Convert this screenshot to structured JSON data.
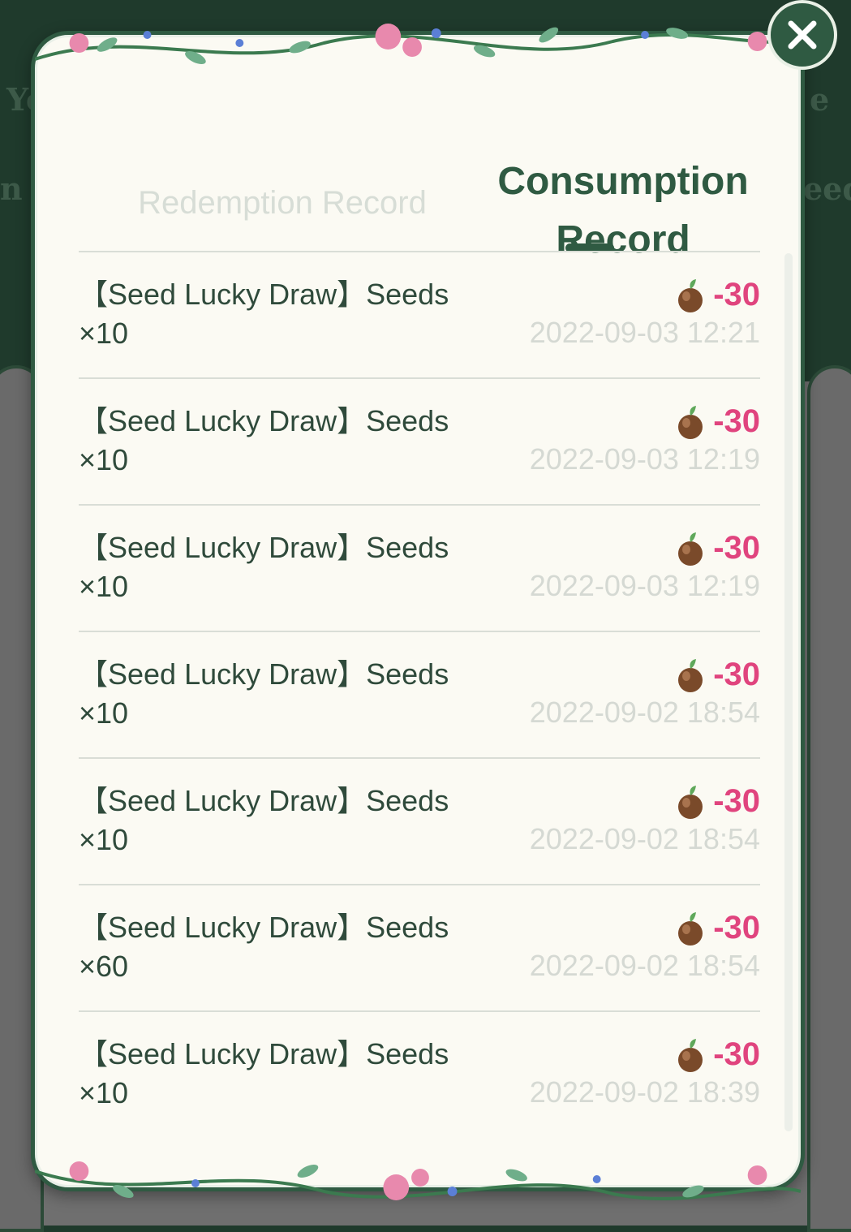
{
  "background": {
    "fringe_left_1": "Yo",
    "fringe_left_2": "n t",
    "fringe_right_1": "e",
    "fringe_right_2": "eed"
  },
  "tabs": {
    "inactive": "Redemption Record",
    "active_line1": "Consumption",
    "active_line2": "Record"
  },
  "colors": {
    "brand_green": "#2f5a42",
    "amount_pink": "#e0447e",
    "muted_gray": "#d5d9d3"
  },
  "records": [
    {
      "title": "【Seed Lucky Draw】Seeds ×10",
      "amount": "-30",
      "time": "2022-09-03 12:21"
    },
    {
      "title": "【Seed Lucky Draw】Seeds ×10",
      "amount": "-30",
      "time": "2022-09-03 12:19"
    },
    {
      "title": "【Seed Lucky Draw】Seeds ×10",
      "amount": "-30",
      "time": "2022-09-03 12:19"
    },
    {
      "title": "【Seed Lucky Draw】Seeds ×10",
      "amount": "-30",
      "time": "2022-09-02 18:54"
    },
    {
      "title": "【Seed Lucky Draw】Seeds ×10",
      "amount": "-30",
      "time": "2022-09-02 18:54"
    },
    {
      "title": "【Seed Lucky Draw】Seeds ×60",
      "amount": "-30",
      "time": "2022-09-02 18:54"
    },
    {
      "title": "【Seed Lucky Draw】Seeds ×10",
      "amount": "-30",
      "time": "2022-09-02 18:39"
    }
  ]
}
